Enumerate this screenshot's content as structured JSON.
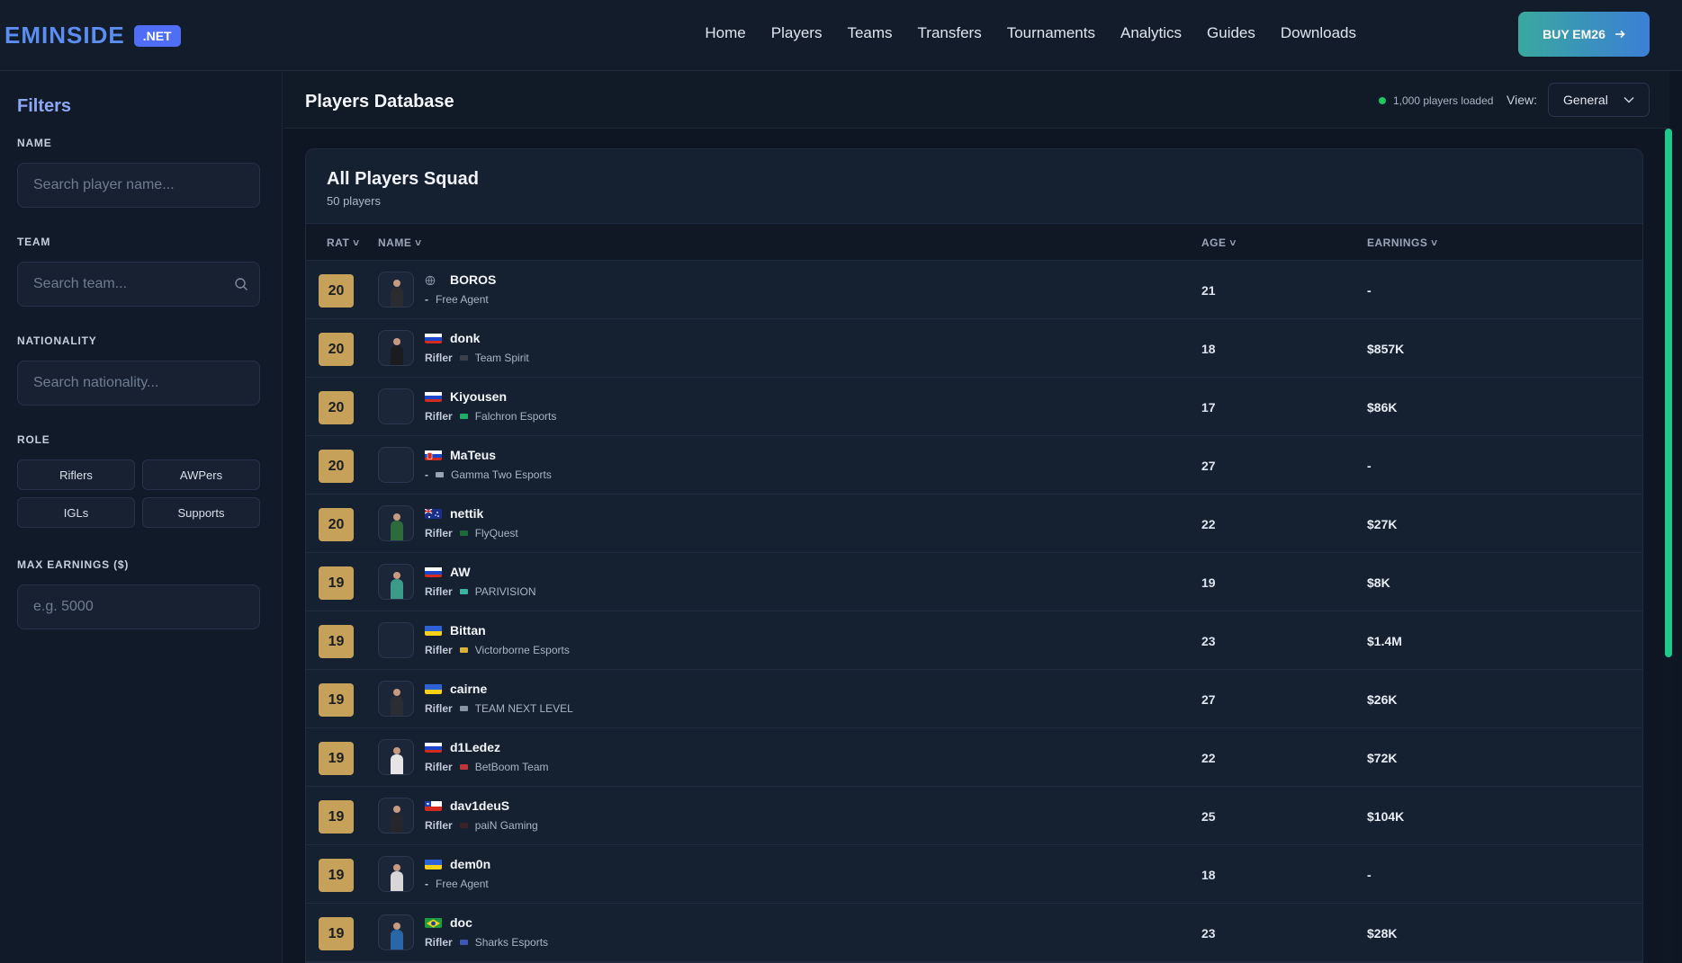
{
  "header": {
    "logo_text": "EMINSIDE",
    "logo_badge": ".NET",
    "nav": [
      "Home",
      "Players",
      "Teams",
      "Transfers",
      "Tournaments",
      "Analytics",
      "Guides",
      "Downloads"
    ],
    "buy_label": "BUY EM26"
  },
  "sidebar": {
    "title": "Filters",
    "name_label": "NAME",
    "name_placeholder": "Search player name...",
    "team_label": "TEAM",
    "team_placeholder": "Search team...",
    "nationality_label": "NATIONALITY",
    "nationality_placeholder": "Search nationality...",
    "role_label": "ROLE",
    "roles": [
      "Riflers",
      "AWPers",
      "IGLs",
      "Supports"
    ],
    "earnings_label": "MAX EARNINGS ($)",
    "earnings_placeholder": "e.g. 5000"
  },
  "main": {
    "title": "Players Database",
    "loaded_text": "1,000 players loaded",
    "view_label": "View:",
    "view_value": "General",
    "squad_title": "All Players Squad",
    "squad_sub": "50 players",
    "columns": {
      "rat": "RAT",
      "name": "NAME",
      "age": "AGE",
      "earnings": "EARNINGS"
    }
  },
  "players": [
    {
      "rat": "20",
      "name": "BOROS",
      "role": "-",
      "team": "Free Agent",
      "age": "21",
      "earnings": "-",
      "flag": "globe",
      "team_color": ""
    },
    {
      "rat": "20",
      "name": "donk",
      "role": "Rifler",
      "team": "Team Spirit",
      "age": "18",
      "earnings": "$857K",
      "flag": "ru",
      "team_color": "#3a3f48"
    },
    {
      "rat": "20",
      "name": "Kiyousen",
      "role": "Rifler",
      "team": "Falchron Esports",
      "age": "17",
      "earnings": "$86K",
      "flag": "ru",
      "team_color": "#1fae6a"
    },
    {
      "rat": "20",
      "name": "MaTeus",
      "role": "-",
      "team": "Gamma Two Esports",
      "age": "27",
      "earnings": "-",
      "flag": "sk",
      "team_color": "#9aa3b0"
    },
    {
      "rat": "20",
      "name": "nettik",
      "role": "Rifler",
      "team": "FlyQuest",
      "age": "22",
      "earnings": "$27K",
      "flag": "au",
      "team_color": "#1e6b3a"
    },
    {
      "rat": "19",
      "name": "AW",
      "role": "Rifler",
      "team": "PARIVISION",
      "age": "19",
      "earnings": "$8K",
      "flag": "ru",
      "team_color": "#3bb3a0"
    },
    {
      "rat": "19",
      "name": "Bittan",
      "role": "Rifler",
      "team": "Victorborne Esports",
      "age": "23",
      "earnings": "$1.4M",
      "flag": "ua",
      "team_color": "#d7b33a"
    },
    {
      "rat": "19",
      "name": "cairne",
      "role": "Rifler",
      "team": "TEAM NEXT LEVEL",
      "age": "27",
      "earnings": "$26K",
      "flag": "ua",
      "team_color": "#8a93a1"
    },
    {
      "rat": "19",
      "name": "d1Ledez",
      "role": "Rifler",
      "team": "BetBoom Team",
      "age": "22",
      "earnings": "$72K",
      "flag": "ru",
      "team_color": "#c0353a"
    },
    {
      "rat": "19",
      "name": "dav1deuS",
      "role": "Rifler",
      "team": "paiN Gaming",
      "age": "25",
      "earnings": "$104K",
      "flag": "cl",
      "team_color": "#3a2226"
    },
    {
      "rat": "19",
      "name": "dem0n",
      "role": "-",
      "team": "Free Agent",
      "age": "18",
      "earnings": "-",
      "flag": "ua",
      "team_color": ""
    },
    {
      "rat": "19",
      "name": "doc",
      "role": "Rifler",
      "team": "Sharks Esports",
      "age": "23",
      "earnings": "$28K",
      "flag": "br",
      "team_color": "#3f57b0"
    }
  ]
}
